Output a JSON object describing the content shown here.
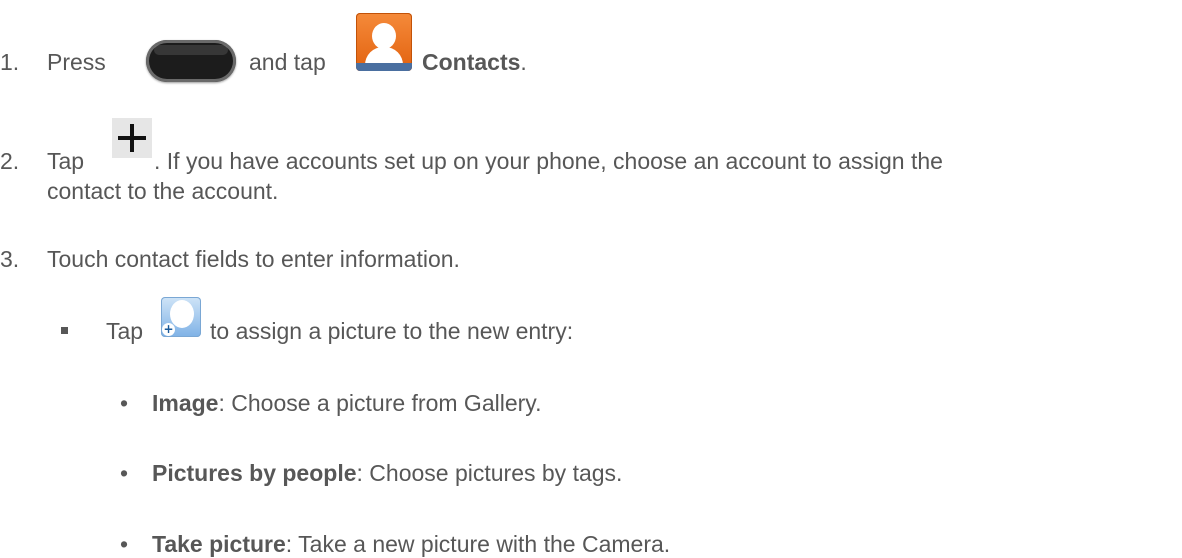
{
  "step1": {
    "number": "1.",
    "text_press": "Press",
    "text_and_tap": "and tap",
    "contacts_label": "Contacts",
    "period": ".",
    "icons": [
      "home-key-icon",
      "contacts-app-icon"
    ]
  },
  "step2": {
    "number": "2.",
    "text_tap": "Tap",
    "text_rest_line1": ". If you have accounts set up on your phone, choose an account to assign the",
    "text_line2": "contact to the account.",
    "icons": [
      "plus-icon"
    ]
  },
  "step3": {
    "number": "3.",
    "text": "Touch contact fields to enter information."
  },
  "substep": {
    "bullet": "square",
    "text_tap": "Tap",
    "text_rest": "to assign a picture to the new entry:",
    "icons": [
      "add-picture-icon"
    ]
  },
  "options": [
    {
      "label": "Image",
      "desc": ": Choose a picture from Gallery."
    },
    {
      "label": "Pictures by people",
      "desc": ": Choose pictures by tags."
    },
    {
      "label": "Take picture",
      "desc": ": Take a new picture with the Camera."
    }
  ]
}
